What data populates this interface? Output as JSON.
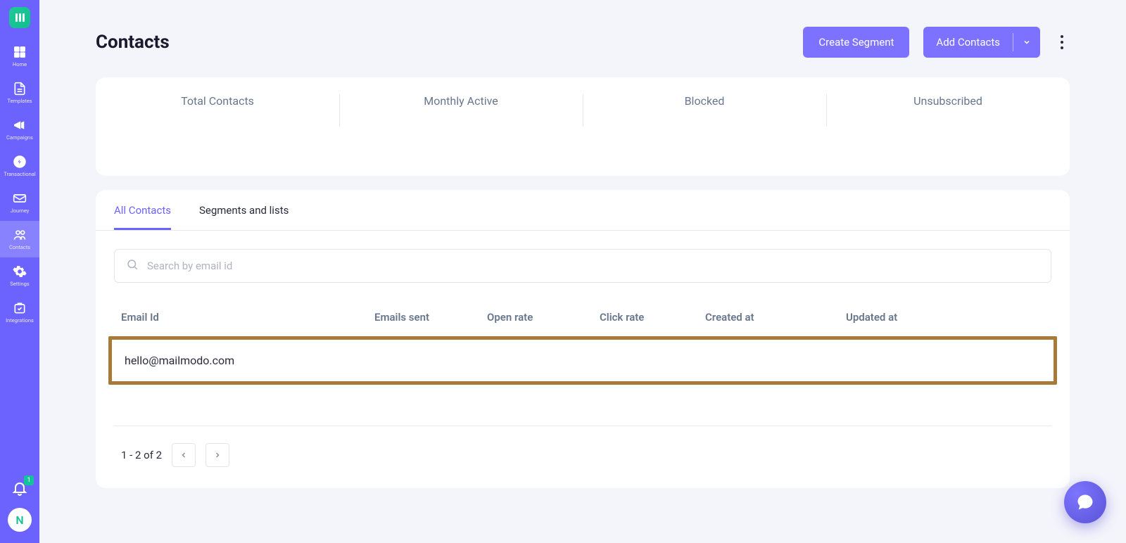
{
  "sidebar": {
    "items": [
      {
        "label": "Home",
        "key": "home"
      },
      {
        "label": "Templates",
        "key": "templates"
      },
      {
        "label": "Campaigns",
        "key": "campaigns"
      },
      {
        "label": "Transactional",
        "key": "transactional"
      },
      {
        "label": "Journey",
        "key": "journey"
      },
      {
        "label": "Contacts",
        "key": "contacts"
      },
      {
        "label": "Settings",
        "key": "settings"
      },
      {
        "label": "Integrations",
        "key": "integrations"
      }
    ],
    "active": "contacts",
    "notification_count": "1",
    "avatar_initial": "N"
  },
  "header": {
    "title": "Contacts",
    "create_segment_label": "Create Segment",
    "add_contacts_label": "Add Contacts"
  },
  "stats": {
    "cells": [
      {
        "label": "Total Contacts"
      },
      {
        "label": "Monthly Active"
      },
      {
        "label": "Blocked"
      },
      {
        "label": "Unsubscribed"
      }
    ]
  },
  "tabs": {
    "all_contacts": "All Contacts",
    "segments_lists": "Segments and lists",
    "active": "all_contacts"
  },
  "search": {
    "placeholder": "Search by email id",
    "value": ""
  },
  "table": {
    "columns": {
      "email": "Email Id",
      "sent": "Emails sent",
      "open": "Open rate",
      "click": "Click rate",
      "created": "Created at",
      "updated": "Updated at"
    },
    "rows": [
      {
        "email": "hello@mailmodo.com",
        "sent": "",
        "open": "",
        "click": "",
        "created": "",
        "updated": ""
      }
    ]
  },
  "pagination": {
    "text": "1 - 2 of 2"
  }
}
